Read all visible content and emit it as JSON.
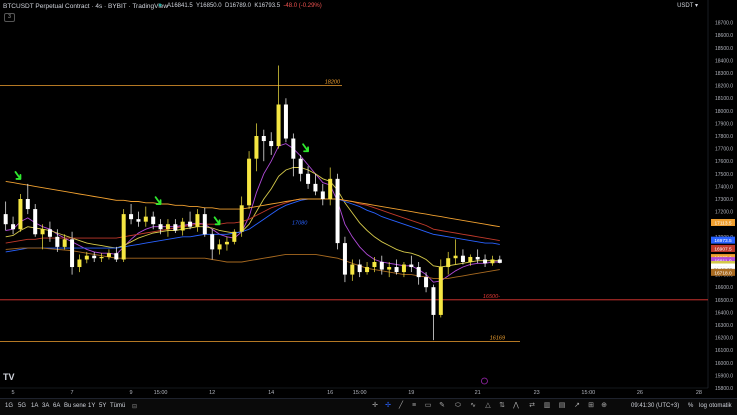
{
  "header": {
    "title": "BTCUSDT Perpetual Contract · 4s · BYBIT · TradingView",
    "ohlc_o": "A16841.5",
    "ohlc_h": "Y16850.0",
    "ohlc_l": "D16789.0",
    "ohlc_c": "K16793.5",
    "ohlc_change": "-48.0 (-0.29%)",
    "collapse_label": "3",
    "currency": "USDT ▾"
  },
  "colors": {
    "background": "#000000",
    "up": "#f5e642",
    "down": "#ffffff",
    "ema_purple": "#b04ad8",
    "ema_yellow": "#d4c84a",
    "ema_orange": "#f0a030",
    "ema_red": "#c0392b",
    "ema_blue": "#2962ff",
    "hline_orange": "#f0a030",
    "hline_red": "#e53935",
    "arrow": "#2ee82e"
  },
  "chart_data": {
    "type": "candlestick",
    "ylim": [
      15800,
      18800
    ],
    "y_ticks": [
      15800,
      15900,
      16000,
      16100,
      16200,
      16300,
      16400,
      16500,
      16600,
      16700,
      16800,
      16900,
      17000,
      17100,
      17200,
      17300,
      17400,
      17500,
      17600,
      17700,
      17800,
      17900,
      18000,
      18100,
      18200,
      18300,
      18400,
      18500,
      18600,
      18700
    ],
    "y_tick_labels": [
      "15800.0",
      "15900.0",
      "16000.0",
      "16100.0",
      "16200.0",
      "16300.0",
      "16400.0",
      "16500.0",
      "16600.0",
      "16700.0",
      "16800.0",
      "16900.0",
      "17000.0",
      "17100.0",
      "17200.0",
      "17300.0",
      "17400.0",
      "17500.0",
      "17600.0",
      "17700.0",
      "17800.0",
      "17900.0",
      "18000.0",
      "18100.0",
      "18200.0",
      "18300.0",
      "18400.0",
      "18500.0",
      "18600.0",
      "18700.0"
    ],
    "x_ticks": [
      {
        "label": "5",
        "i": 1
      },
      {
        "label": "7",
        "i": 9
      },
      {
        "label": "9",
        "i": 17
      },
      {
        "label": "15:00",
        "i": 21
      },
      {
        "label": "12",
        "i": 28
      },
      {
        "label": "14",
        "i": 36
      },
      {
        "label": "16",
        "i": 44
      },
      {
        "label": "15:00",
        "i": 48
      },
      {
        "label": "19",
        "i": 55
      },
      {
        "label": "21",
        "i": 64
      },
      {
        "label": "23",
        "i": 72
      },
      {
        "label": "15:00",
        "i": 79
      },
      {
        "label": "26",
        "i": 86
      },
      {
        "label": "28",
        "i": 94
      }
    ],
    "n_slots": 96,
    "candles": [
      [
        17180,
        17280,
        17050,
        17100
      ],
      [
        17100,
        17160,
        17020,
        17060
      ],
      [
        17060,
        17340,
        17040,
        17300
      ],
      [
        17300,
        17420,
        17180,
        17220
      ],
      [
        17220,
        17260,
        17000,
        17020
      ],
      [
        17020,
        17100,
        16900,
        17060
      ],
      [
        17060,
        17120,
        16960,
        17000
      ],
      [
        17000,
        17060,
        16880,
        16920
      ],
      [
        16920,
        17020,
        16900,
        16980
      ],
      [
        16980,
        17040,
        16700,
        16760
      ],
      [
        16760,
        16860,
        16720,
        16820
      ],
      [
        16820,
        16880,
        16790,
        16850
      ],
      [
        16850,
        16880,
        16800,
        16830
      ],
      [
        16830,
        16870,
        16800,
        16840
      ],
      [
        16840,
        16900,
        16820,
        16870
      ],
      [
        16870,
        16920,
        16800,
        16820
      ],
      [
        16820,
        17220,
        16800,
        17180
      ],
      [
        17180,
        17260,
        17100,
        17140
      ],
      [
        17140,
        17200,
        17080,
        17120
      ],
      [
        17120,
        17240,
        17080,
        17160
      ],
      [
        17160,
        17200,
        17060,
        17100
      ],
      [
        17100,
        17140,
        17020,
        17060
      ],
      [
        17060,
        17140,
        17000,
        17100
      ],
      [
        17100,
        17140,
        17030,
        17050
      ],
      [
        17050,
        17150,
        17010,
        17120
      ],
      [
        17120,
        17200,
        17060,
        17080
      ],
      [
        17080,
        17220,
        17040,
        17180
      ],
      [
        17180,
        17230,
        17000,
        17020
      ],
      [
        17020,
        17060,
        16820,
        16900
      ],
      [
        16900,
        16980,
        16860,
        16940
      ],
      [
        16940,
        17000,
        16890,
        16960
      ],
      [
        16960,
        17060,
        16940,
        17040
      ],
      [
        17040,
        17320,
        17000,
        17250
      ],
      [
        17250,
        17680,
        17220,
        17620
      ],
      [
        17620,
        17900,
        17520,
        17800
      ],
      [
        17800,
        17850,
        17600,
        17760
      ],
      [
        17760,
        17830,
        17650,
        17720
      ],
      [
        17720,
        18360,
        17700,
        18050
      ],
      [
        18050,
        18100,
        17750,
        17780
      ],
      [
        17780,
        17820,
        17480,
        17620
      ],
      [
        17620,
        17650,
        17440,
        17500
      ],
      [
        17500,
        17560,
        17380,
        17420
      ],
      [
        17420,
        17500,
        17330,
        17360
      ],
      [
        17360,
        17420,
        17250,
        17300
      ],
      [
        17300,
        17550,
        17250,
        17460
      ],
      [
        17460,
        17500,
        16900,
        16950
      ],
      [
        16950,
        17000,
        16640,
        16700
      ],
      [
        16700,
        16820,
        16650,
        16780
      ],
      [
        16780,
        16820,
        16680,
        16720
      ],
      [
        16720,
        16800,
        16700,
        16760
      ],
      [
        16760,
        16840,
        16720,
        16800
      ],
      [
        16800,
        16850,
        16700,
        16740
      ],
      [
        16740,
        16800,
        16680,
        16760
      ],
      [
        16760,
        16820,
        16700,
        16720
      ],
      [
        16720,
        16800,
        16680,
        16780
      ],
      [
        16780,
        16850,
        16720,
        16760
      ],
      [
        16760,
        16800,
        16620,
        16680
      ],
      [
        16680,
        16720,
        16560,
        16600
      ],
      [
        16600,
        16620,
        16180,
        16380
      ],
      [
        16380,
        16820,
        16360,
        16760
      ],
      [
        16760,
        16880,
        16700,
        16830
      ],
      [
        16830,
        16980,
        16780,
        16850
      ],
      [
        16850,
        16900,
        16780,
        16800
      ],
      [
        16800,
        16860,
        16770,
        16840
      ],
      [
        16840,
        16900,
        16790,
        16820
      ],
      [
        16820,
        16860,
        16760,
        16790
      ],
      [
        16790,
        16850,
        16770,
        16820
      ],
      [
        16820,
        16850,
        16789,
        16793
      ]
    ],
    "lines": [
      {
        "color": "#b04ad8",
        "values": [
          17050,
          17060,
          17120,
          17150,
          17110,
          17080,
          17060,
          17020,
          16990,
          16960,
          16930,
          16900,
          16880,
          16870,
          16870,
          16860,
          16920,
          16980,
          17030,
          17060,
          17080,
          17080,
          17080,
          17080,
          17090,
          17100,
          17110,
          17100,
          17060,
          17020,
          17000,
          16990,
          17040,
          17160,
          17350,
          17500,
          17600,
          17720,
          17740,
          17700,
          17640,
          17570,
          17500,
          17430,
          17410,
          17280,
          17100,
          17000,
          16920,
          16860,
          16820,
          16800,
          16790,
          16780,
          16770,
          16770,
          16740,
          16700,
          16640,
          16650,
          16690,
          16730,
          16760,
          16780,
          16790,
          16790,
          16800,
          16800
        ]
      },
      {
        "color": "#d4c84a",
        "values": [
          17000,
          17010,
          17050,
          17080,
          17070,
          17060,
          17050,
          17030,
          17010,
          16990,
          16970,
          16950,
          16940,
          16930,
          16920,
          16910,
          16930,
          16960,
          16990,
          17010,
          17030,
          17040,
          17050,
          17050,
          17060,
          17070,
          17080,
          17080,
          17070,
          17050,
          17040,
          17030,
          17040,
          17100,
          17200,
          17300,
          17380,
          17480,
          17530,
          17550,
          17550,
          17530,
          17500,
          17460,
          17440,
          17370,
          17270,
          17190,
          17110,
          17050,
          17000,
          16960,
          16930,
          16900,
          16880,
          16870,
          16850,
          16820,
          16770,
          16760,
          16770,
          16780,
          16790,
          16800,
          16810,
          16810,
          16810,
          16810
        ]
      },
      {
        "color": "#2962ff",
        "values": [
          16880,
          16890,
          16900,
          16910,
          16910,
          16910,
          16910,
          16910,
          16910,
          16910,
          16910,
          16910,
          16910,
          16910,
          16910,
          16910,
          16920,
          16930,
          16940,
          16950,
          16960,
          16970,
          16980,
          16990,
          17000,
          17000,
          17010,
          17020,
          17020,
          17020,
          17020,
          17030,
          17040,
          17060,
          17100,
          17140,
          17180,
          17220,
          17250,
          17270,
          17290,
          17300,
          17300,
          17300,
          17300,
          17300,
          17280,
          17260,
          17240,
          17210,
          17190,
          17160,
          17140,
          17120,
          17100,
          17080,
          17060,
          17040,
          17020,
          17010,
          17000,
          16990,
          16980,
          16970,
          16960,
          16950,
          16950,
          16940
        ]
      },
      {
        "color": "#c0392b",
        "values": [
          16950,
          16960,
          16970,
          16980,
          16980,
          16990,
          16990,
          16990,
          16990,
          16990,
          16990,
          16990,
          16990,
          16990,
          16990,
          16990,
          17000,
          17010,
          17020,
          17030,
          17040,
          17050,
          17060,
          17070,
          17080,
          17090,
          17100,
          17100,
          17100,
          17100,
          17110,
          17110,
          17120,
          17140,
          17170,
          17200,
          17230,
          17250,
          17270,
          17290,
          17300,
          17300,
          17300,
          17300,
          17300,
          17300,
          17290,
          17280,
          17260,
          17250,
          17230,
          17210,
          17190,
          17170,
          17150,
          17130,
          17110,
          17090,
          17060,
          17050,
          17040,
          17030,
          17020,
          17010,
          17000,
          16990,
          16980,
          16970
        ]
      },
      {
        "color": "#f0a030",
        "values": [
          17440,
          17430,
          17420,
          17410,
          17400,
          17390,
          17380,
          17370,
          17360,
          17350,
          17340,
          17330,
          17320,
          17310,
          17300,
          17290,
          17290,
          17280,
          17280,
          17270,
          17270,
          17260,
          17260,
          17250,
          17250,
          17240,
          17240,
          17230,
          17230,
          17220,
          17220,
          17220,
          17220,
          17230,
          17240,
          17250,
          17260,
          17270,
          17280,
          17290,
          17300,
          17300,
          17300,
          17300,
          17300,
          17300,
          17290,
          17280,
          17270,
          17260,
          17250,
          17240,
          17230,
          17220,
          17210,
          17200,
          17190,
          17180,
          17170,
          17160,
          17150,
          17140,
          17130,
          17120,
          17110,
          17100,
          17090,
          17080
        ]
      },
      {
        "color": "#a86a20",
        "values": [
          16900,
          16905,
          16910,
          16910,
          16910,
          16910,
          16905,
          16900,
          16895,
          16890,
          16880,
          16870,
          16860,
          16850,
          16840,
          16830,
          16830,
          16830,
          16830,
          16830,
          16830,
          16830,
          16830,
          16830,
          16830,
          16830,
          16830,
          16830,
          16820,
          16810,
          16800,
          16800,
          16800,
          16810,
          16820,
          16830,
          16840,
          16850,
          16860,
          16860,
          16860,
          16860,
          16860,
          16850,
          16840,
          16830,
          16810,
          16790,
          16770,
          16750,
          16740,
          16730,
          16720,
          16710,
          16700,
          16700,
          16690,
          16680,
          16670,
          16670,
          16670,
          16680,
          16690,
          16700,
          16710,
          16720,
          16730,
          16740
        ]
      }
    ],
    "hlines": [
      {
        "price": 18200,
        "label": "18200",
        "x_from": 0,
        "x_to": 342,
        "color": "#f0a030"
      },
      {
        "price": 16500,
        "label": "16500-",
        "x_from": 0,
        "x_to": 708,
        "color": "#e53935"
      },
      {
        "price": 16169,
        "label": "16169",
        "x_from": 0,
        "x_to": 520,
        "color": "#f0a030"
      },
      {
        "price": 17080,
        "label": "17080",
        "x_from": 290,
        "x_to": 290,
        "color": "#2962ff"
      }
    ],
    "arrows_at": [
      2,
      21,
      29,
      41
    ],
    "price_tags": [
      {
        "label": "17113.5",
        "color": "#f0a030",
        "price": 17113.5
      },
      {
        "label": "16973.5",
        "color": "#2962ff",
        "price": 16973.5
      },
      {
        "label": "16907.5",
        "color": "#c0392b",
        "price": 16907.5
      },
      {
        "label": "16835.0",
        "color": "#f0a030",
        "price": 16835
      },
      {
        "label": "16811.0",
        "color": "#b04ad8",
        "price": 16811
      },
      {
        "label": "16813.0",
        "color": "#d4c84a",
        "price": 16780
      },
      {
        "label": "16793.5",
        "color": "#ffffff",
        "price": 16760
      },
      {
        "label": "01:18:30",
        "color": "#ffffff",
        "price": 16740
      },
      {
        "label": "16718.0",
        "color": "#a86a20",
        "price": 16718
      }
    ]
  },
  "toolbar": {
    "tf_1g": "1G",
    "tf_5g": "5G",
    "tf_1a": "1A",
    "tf_3a": "3A",
    "tf_6a": "6A",
    "tf_busene": "Bu sene",
    "tf_1y": "1Y",
    "tf_5y": "5Y",
    "tf_tumu": "Tümü",
    "time": "09:41:30 (UTC+3)",
    "percent": "%",
    "log": "log",
    "auto": "otomatik"
  }
}
